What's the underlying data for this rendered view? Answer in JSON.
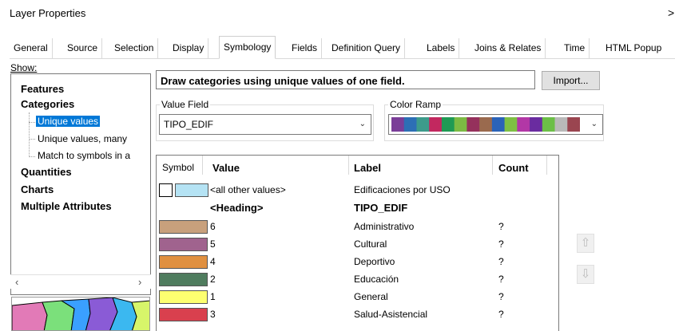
{
  "window": {
    "title": "Layer Properties",
    "close_glyph": ">"
  },
  "tabs": [
    {
      "label": "General"
    },
    {
      "label": "Source"
    },
    {
      "label": "Selection"
    },
    {
      "label": "Display"
    },
    {
      "label": "Symbology",
      "active": true
    },
    {
      "label": "Fields"
    },
    {
      "label": "Definition Query"
    },
    {
      "label": "Labels"
    },
    {
      "label": "Joins & Relates"
    },
    {
      "label": "Time"
    },
    {
      "label": "HTML Popup"
    }
  ],
  "show": {
    "label": "Show:",
    "tree": [
      {
        "label": "Features",
        "bold": true
      },
      {
        "label": "Categories",
        "bold": true
      },
      {
        "label": "Unique values",
        "selected": true
      },
      {
        "label": "Unique values, many"
      },
      {
        "label": "Match to symbols in a"
      },
      {
        "label": "Quantities",
        "bold": true
      },
      {
        "label": "Charts",
        "bold": true
      },
      {
        "label": "Multiple Attributes",
        "bold": true
      }
    ]
  },
  "heading": "Draw categories using unique values of one field.",
  "import_button": "Import...",
  "value_field": {
    "label": "Value Field",
    "value": "TIPO_EDIF"
  },
  "color_ramp": {
    "label": "Color Ramp",
    "colors": [
      "#7a3e98",
      "#2d6fb5",
      "#3d9b8b",
      "#c2285f",
      "#1f9a54",
      "#7cba43",
      "#95315c",
      "#9a6a4e",
      "#2b63b8",
      "#7ec043",
      "#b237a6",
      "#6a2ca0",
      "#6cbf47",
      "#b9b9b9",
      "#9a4550"
    ]
  },
  "table": {
    "headers": {
      "symbol": "Symbol",
      "value": "Value",
      "label": "Label",
      "count": "Count"
    },
    "other_row": {
      "value": "<all other values>",
      "label": "Edificaciones por USO",
      "color": "#b5e3f4"
    },
    "heading_row": {
      "value": "<Heading>",
      "label": "TIPO_EDIF"
    },
    "rows": [
      {
        "value": "6",
        "label": "Administrativo",
        "count": "?",
        "color": "#c8a07c"
      },
      {
        "value": "5",
        "label": "Cultural",
        "count": "?",
        "color": "#a0638e"
      },
      {
        "value": "4",
        "label": "Deportivo",
        "count": "?",
        "color": "#e09040"
      },
      {
        "value": "2",
        "label": "Educación",
        "count": "?",
        "color": "#4f7c5e"
      },
      {
        "value": "1",
        "label": "General",
        "count": "?",
        "color": "#fdff70"
      },
      {
        "value": "3",
        "label": "Salud-Asistencial",
        "count": "?",
        "color": "#d9404e"
      }
    ]
  },
  "icons": {
    "up": "arrow-up-icon",
    "down": "arrow-down-icon"
  }
}
